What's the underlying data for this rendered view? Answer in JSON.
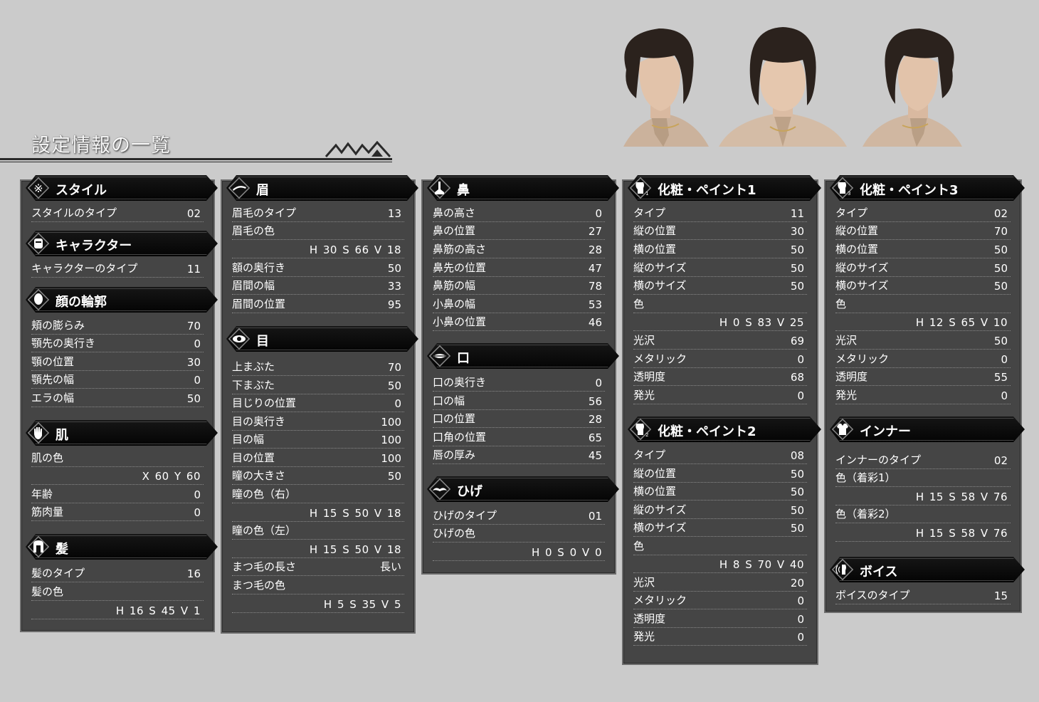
{
  "title": "設定情報の一覧",
  "columns": [
    {
      "sections": [
        {
          "icon": "style-icon",
          "title": "スタイル",
          "rows": [
            {
              "label": "スタイルのタイプ",
              "value": "02"
            }
          ]
        },
        {
          "icon": "character-icon",
          "title": "キャラクター",
          "rows": [
            {
              "label": "キャラクターのタイプ",
              "value": "11"
            }
          ]
        },
        {
          "icon": "face-contour-icon",
          "title": "顔の輪郭",
          "rows": [
            {
              "label": "頬の膨らみ",
              "value": "70"
            },
            {
              "label": "顎先の奥行き",
              "value": "0"
            },
            {
              "label": "顎の位置",
              "value": "30"
            },
            {
              "label": "顎先の幅",
              "value": "0"
            },
            {
              "label": "エラの幅",
              "value": "50"
            }
          ]
        },
        {
          "icon": "skin-hand-icon",
          "title": "肌",
          "rows": [
            {
              "label": "肌の色",
              "value": ""
            },
            {
              "label": "",
              "value": "X  60    Y  60"
            },
            {
              "label": "年齢",
              "value": "0"
            },
            {
              "label": "筋肉量",
              "value": "0"
            }
          ]
        },
        {
          "icon": "hair-icon",
          "title": "髪",
          "rows": [
            {
              "label": "髪のタイプ",
              "value": "16"
            },
            {
              "label": "髪の色",
              "value": ""
            },
            {
              "label": "",
              "value": "H  16    S  45    V    1"
            }
          ]
        }
      ]
    },
    {
      "sections": [
        {
          "icon": "eyebrow-icon",
          "title": "眉",
          "rows": [
            {
              "label": "眉毛のタイプ",
              "value": "13"
            },
            {
              "label": "眉毛の色",
              "value": ""
            },
            {
              "label": "",
              "value": "H  30    S  66    V  18"
            },
            {
              "label": "額の奥行き",
              "value": "50"
            },
            {
              "label": "眉間の幅",
              "value": "33"
            },
            {
              "label": "眉間の位置",
              "value": "95"
            }
          ]
        },
        {
          "icon": "eye-icon",
          "title": "目",
          "rows": [
            {
              "label": "上まぶた",
              "value": "70"
            },
            {
              "label": "下まぶた",
              "value": "50"
            },
            {
              "label": "目じりの位置",
              "value": "0"
            },
            {
              "label": "目の奥行き",
              "value": "100"
            },
            {
              "label": "目の幅",
              "value": "100"
            },
            {
              "label": "目の位置",
              "value": "100"
            },
            {
              "label": "瞳の大きさ",
              "value": "50"
            },
            {
              "label": "瞳の色（右）",
              "value": ""
            },
            {
              "label": "",
              "value": "H  15    S  50    V  18"
            },
            {
              "label": "瞳の色（左）",
              "value": ""
            },
            {
              "label": "",
              "value": "H  15    S  50    V  18"
            },
            {
              "label": "まつ毛の長さ",
              "value": "長い"
            },
            {
              "label": "まつ毛の色",
              "value": ""
            },
            {
              "label": "",
              "value": "H    5    S  35    V    5"
            }
          ]
        }
      ]
    },
    {
      "sections": [
        {
          "icon": "nose-icon",
          "title": "鼻",
          "rows": [
            {
              "label": "鼻の高さ",
              "value": "0"
            },
            {
              "label": "鼻の位置",
              "value": "27"
            },
            {
              "label": "鼻筋の高さ",
              "value": "28"
            },
            {
              "label": "鼻先の位置",
              "value": "47"
            },
            {
              "label": "鼻筋の幅",
              "value": "78"
            },
            {
              "label": "小鼻の幅",
              "value": "53"
            },
            {
              "label": "小鼻の位置",
              "value": "46"
            }
          ]
        },
        {
          "icon": "mouth-icon",
          "title": "口",
          "rows": [
            {
              "label": "口の奥行き",
              "value": "0"
            },
            {
              "label": "口の幅",
              "value": "56"
            },
            {
              "label": "口の位置",
              "value": "28"
            },
            {
              "label": "口角の位置",
              "value": "65"
            },
            {
              "label": "唇の厚み",
              "value": "45"
            }
          ]
        },
        {
          "icon": "beard-icon",
          "title": "ひげ",
          "rows": [
            {
              "label": "ひげのタイプ",
              "value": "01"
            },
            {
              "label": "ひげの色",
              "value": ""
            },
            {
              "label": "",
              "value": "H    0    S    0    V    0"
            }
          ]
        }
      ]
    },
    {
      "sections": [
        {
          "icon": "makeup-1-icon",
          "title": "化粧・ペイント1",
          "rows": [
            {
              "label": "タイプ",
              "value": "11"
            },
            {
              "label": "縦の位置",
              "value": "30"
            },
            {
              "label": "横の位置",
              "value": "50"
            },
            {
              "label": "縦のサイズ",
              "value": "50"
            },
            {
              "label": "横のサイズ",
              "value": "50"
            },
            {
              "label": "色",
              "value": ""
            },
            {
              "label": "",
              "value": "H    0    S  83    V  25"
            },
            {
              "label": "光沢",
              "value": "69"
            },
            {
              "label": "メタリック",
              "value": "0"
            },
            {
              "label": "透明度",
              "value": "68"
            },
            {
              "label": "発光",
              "value": "0"
            }
          ]
        },
        {
          "icon": "makeup-2-icon",
          "title": "化粧・ペイント2",
          "rows": [
            {
              "label": "タイプ",
              "value": "08"
            },
            {
              "label": "縦の位置",
              "value": "50"
            },
            {
              "label": "横の位置",
              "value": "50"
            },
            {
              "label": "縦のサイズ",
              "value": "50"
            },
            {
              "label": "横のサイズ",
              "value": "50"
            },
            {
              "label": "色",
              "value": ""
            },
            {
              "label": "",
              "value": "H    8    S  70    V  40"
            },
            {
              "label": "光沢",
              "value": "20"
            },
            {
              "label": "メタリック",
              "value": "0"
            },
            {
              "label": "透明度",
              "value": "0"
            },
            {
              "label": "発光",
              "value": "0"
            }
          ]
        }
      ]
    },
    {
      "sections": [
        {
          "icon": "makeup-3-icon",
          "title": "化粧・ペイント3",
          "rows": [
            {
              "label": "タイプ",
              "value": "02"
            },
            {
              "label": "縦の位置",
              "value": "70"
            },
            {
              "label": "横の位置",
              "value": "50"
            },
            {
              "label": "縦のサイズ",
              "value": "50"
            },
            {
              "label": "横のサイズ",
              "value": "50"
            },
            {
              "label": "色",
              "value": ""
            },
            {
              "label": "",
              "value": "H  12    S  65    V  10"
            },
            {
              "label": "光沢",
              "value": "50"
            },
            {
              "label": "メタリック",
              "value": "0"
            },
            {
              "label": "透明度",
              "value": "55"
            },
            {
              "label": "発光",
              "value": "0"
            }
          ]
        },
        {
          "icon": "inner-wear-icon",
          "title": "インナー",
          "rows": [
            {
              "label": "インナーのタイプ",
              "value": "02"
            },
            {
              "label": "色（着彩1）",
              "value": ""
            },
            {
              "label": "",
              "value": "H  15    S  58    V  76"
            },
            {
              "label": "色（着彩2）",
              "value": ""
            },
            {
              "label": "",
              "value": "H  15    S  58    V  76"
            }
          ]
        },
        {
          "icon": "voice-icon",
          "title": "ボイス",
          "rows": [
            {
              "label": "ボイスのタイプ",
              "value": "15"
            }
          ]
        }
      ]
    }
  ]
}
